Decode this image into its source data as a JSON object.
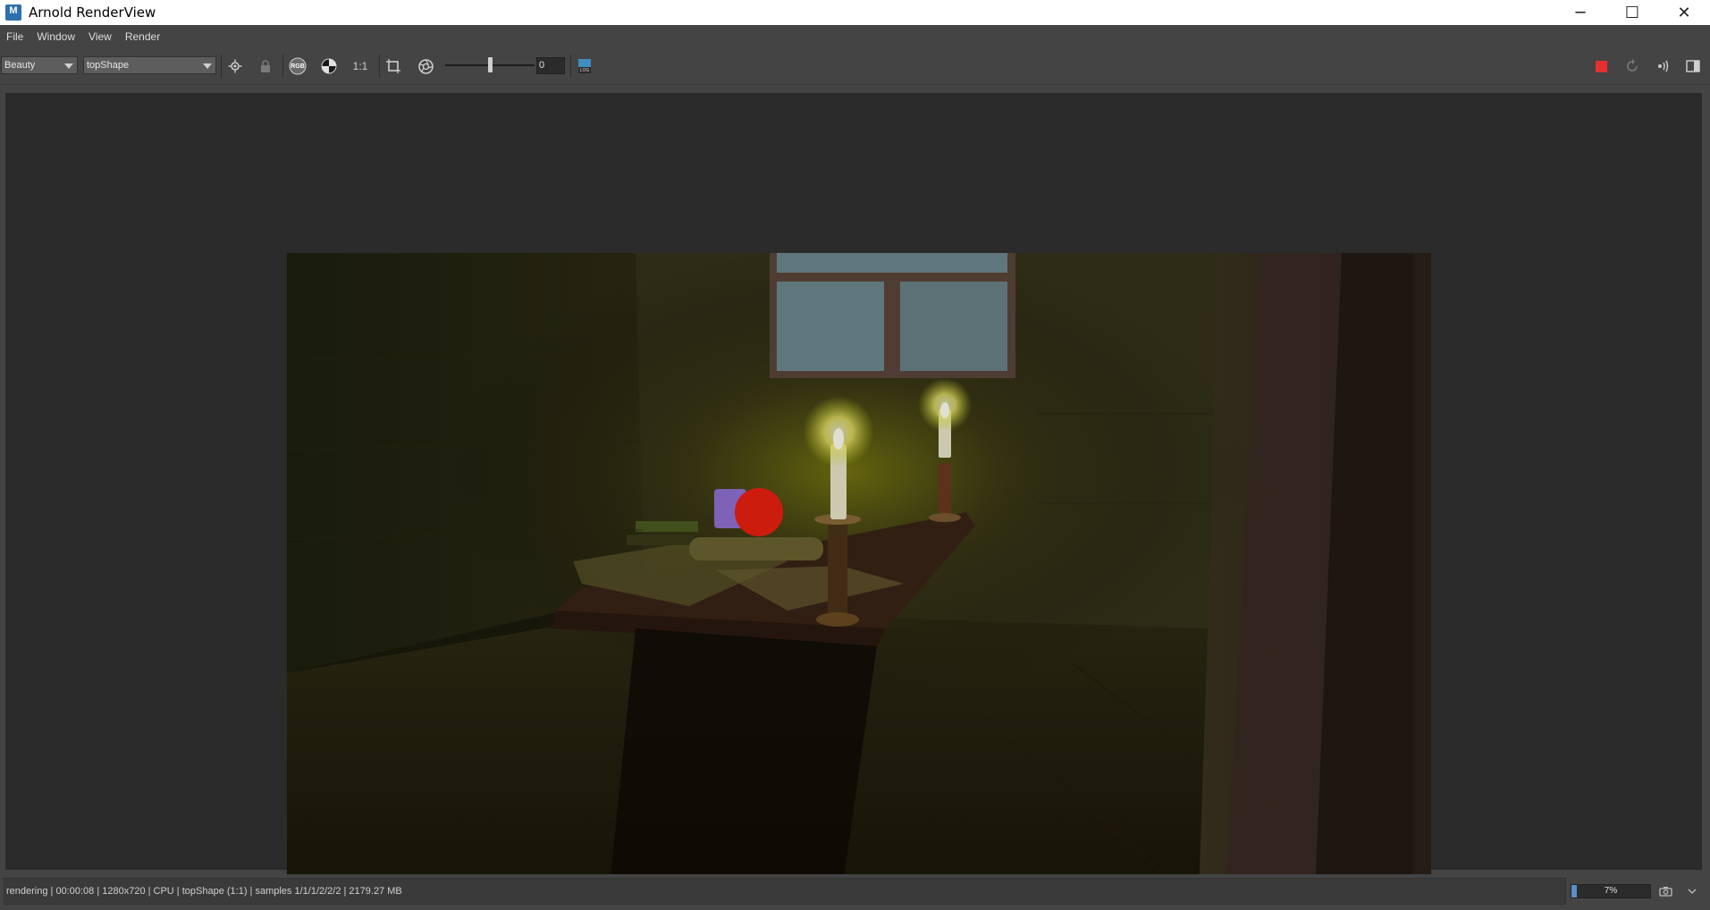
{
  "window": {
    "title": "Arnold RenderView",
    "app_icon_letter": "M",
    "minimize_glyph": "─",
    "maximize_glyph": "☐",
    "close_glyph": "✕"
  },
  "menu": {
    "items": [
      "File",
      "Window",
      "View",
      "Render"
    ]
  },
  "toolbar": {
    "aov_value": "Beauty",
    "camera_value": "topShape",
    "ratio_label": "1:1",
    "exposure_value": "0",
    "exposure_fraction": 0.5,
    "icons": [
      "display-settings-icon",
      "lock-icon",
      "rgb-channel-icon",
      "checker-icon",
      "zoom-ratio-icon",
      "crop-region-icon",
      "aperture-icon",
      "lut-icon",
      "stop-render-icon",
      "refresh-icon",
      "debug-shading-icon",
      "panel-toggle-icon"
    ],
    "rgb_glyph": "RGB",
    "lut_glyph": "LOG",
    "stop_color": "#e53030"
  },
  "status": {
    "text": "rendering | 00:00:08 | 1280x720 | CPU | topShape (1:1) | samples 1/1/1/2/2/2 | 2179.27 MB",
    "progress_percent": 7,
    "progress_label": "7%"
  },
  "render": {
    "resolution": "1280x720",
    "accent_colors": {
      "candle_glow": "#d8e040",
      "apple": "#e82010",
      "purple_cube": "#9070d0"
    }
  }
}
